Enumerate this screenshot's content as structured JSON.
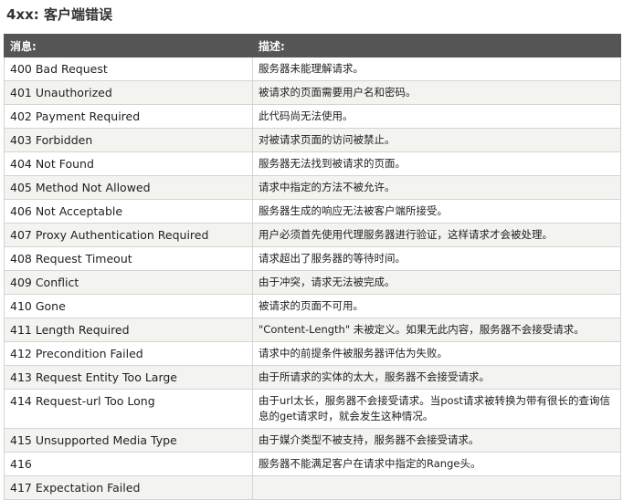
{
  "page": {
    "title": "4xx: 客户端错误"
  },
  "table": {
    "headers": [
      "消息:",
      "描述:"
    ],
    "rows": [
      {
        "code": "400 Bad Request",
        "desc": "服务器未能理解请求。"
      },
      {
        "code": "401 Unauthorized",
        "desc": "被请求的页面需要用户名和密码。"
      },
      {
        "code": "402 Payment Required",
        "desc": "此代码尚无法使用。"
      },
      {
        "code": "403 Forbidden",
        "desc": "对被请求页面的访问被禁止。"
      },
      {
        "code": "404 Not Found",
        "desc": "服务器无法找到被请求的页面。"
      },
      {
        "code": "405 Method Not Allowed",
        "desc": "请求中指定的方法不被允许。"
      },
      {
        "code": "406 Not Acceptable",
        "desc": "服务器生成的响应无法被客户端所接受。"
      },
      {
        "code": "407 Proxy Authentication Required",
        "desc": "用户必须首先使用代理服务器进行验证，这样请求才会被处理。"
      },
      {
        "code": "408 Request Timeout",
        "desc": "请求超出了服务器的等待时间。"
      },
      {
        "code": "409 Conflict",
        "desc": "由于冲突，请求无法被完成。"
      },
      {
        "code": "410 Gone",
        "desc": "被请求的页面不可用。"
      },
      {
        "code": "411 Length Required",
        "desc": "\"Content-Length\" 未被定义。如果无此内容，服务器不会接受请求。"
      },
      {
        "code": "412 Precondition Failed",
        "desc": "请求中的前提条件被服务器评估为失败。"
      },
      {
        "code": "413 Request Entity Too Large",
        "desc": "由于所请求的实体的太大，服务器不会接受请求。"
      },
      {
        "code": "414 Request-url Too Long",
        "desc": "由于url太长，服务器不会接受请求。当post请求被转换为带有很长的查询信息的get请求时，就会发生这种情况。"
      },
      {
        "code": "415 Unsupported Media Type",
        "desc": "由于媒介类型不被支持，服务器不会接受请求。"
      },
      {
        "code": "416",
        "desc": "服务器不能满足客户在请求中指定的Range头。"
      },
      {
        "code": "417 Expectation Failed",
        "desc": ""
      }
    ]
  },
  "colors": {
    "header_bg": "#555555",
    "header_text": "#ffffff",
    "row_alt_bg": "#f3f3f0",
    "border": "#d4d4d4"
  }
}
